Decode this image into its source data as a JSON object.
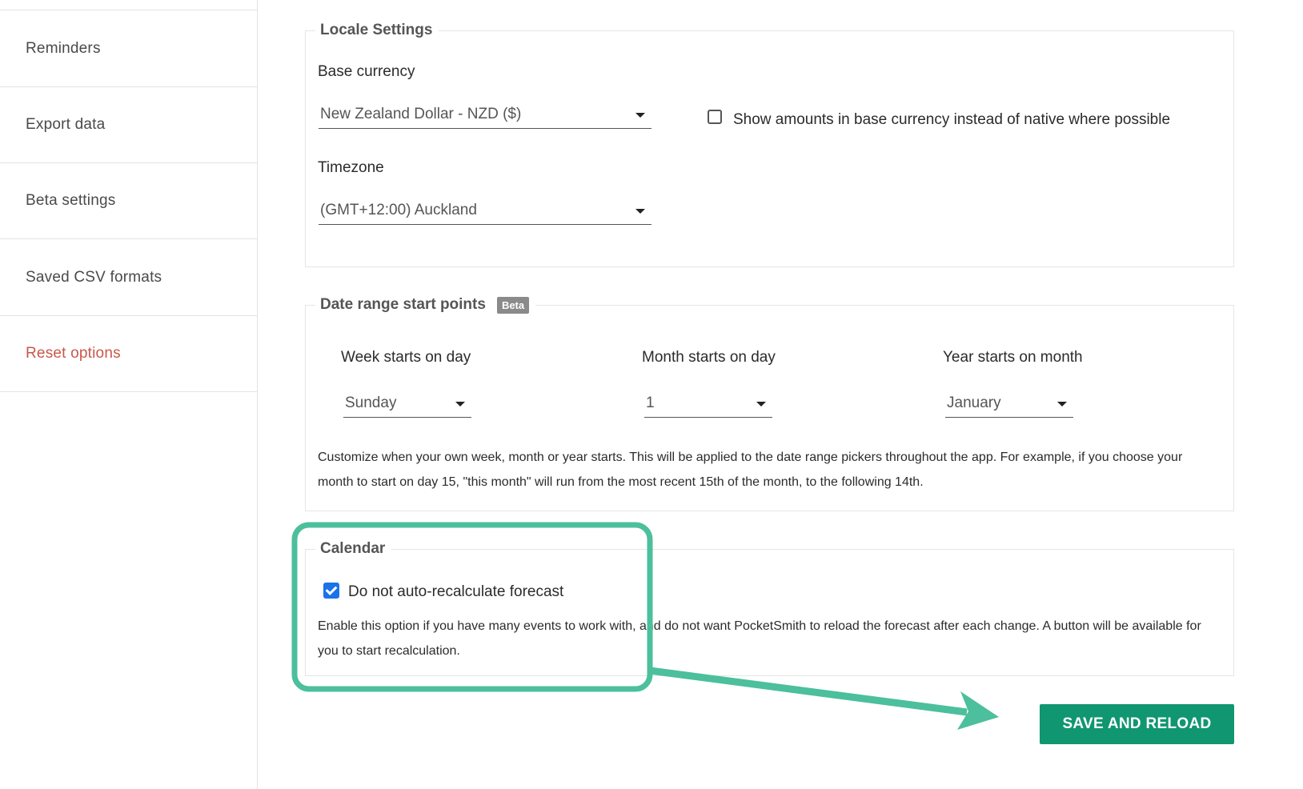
{
  "sidebar": {
    "items": [
      {
        "label": "Reminders",
        "danger": false
      },
      {
        "label": "Export data",
        "danger": false
      },
      {
        "label": "Beta settings",
        "danger": false
      },
      {
        "label": "Saved CSV formats",
        "danger": false
      },
      {
        "label": "Reset options",
        "danger": true
      }
    ]
  },
  "locale": {
    "legend": "Locale Settings",
    "base_currency_label": "Base currency",
    "base_currency_value": "New Zealand Dollar - NZD ($)",
    "show_base_label": "Show amounts in base currency instead of native where possible",
    "show_base_checked": false,
    "timezone_label": "Timezone",
    "timezone_value": "(GMT+12:00) Auckland"
  },
  "date_range": {
    "legend": "Date range start points",
    "badge": "Beta",
    "week_label": "Week starts on day",
    "week_value": "Sunday",
    "month_label": "Month starts on day",
    "month_value": "1",
    "year_label": "Year starts on month",
    "year_value": "January",
    "help": "Customize when your own week, month or year starts. This will be applied to the date range pickers throughout the app. For example, if you choose your month to start on day 15, \"this month\" will run from the most recent 15th of the month, to the following 14th."
  },
  "calendar": {
    "legend": "Calendar",
    "option_label": "Do not auto-recalculate forecast",
    "option_checked": true,
    "help": "Enable this option if you have many events to work with, and do not want PocketSmith to reload the forecast after each change. A button will be available for you to start recalculation."
  },
  "actions": {
    "save_label": "SAVE AND RELOAD"
  },
  "colors": {
    "accent": "#109670",
    "annotation": "#4cbf9c",
    "danger": "#c9574a",
    "checkbox": "#1a73e8"
  }
}
